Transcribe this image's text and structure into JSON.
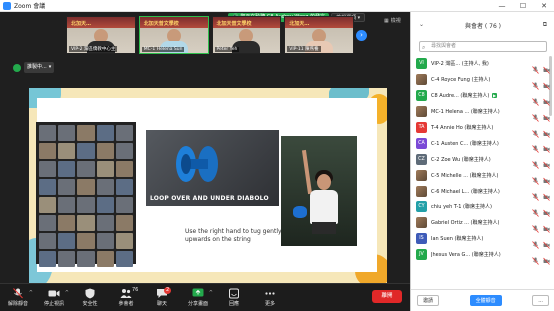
{
  "window": {
    "title": "Zoom 會議",
    "controls": [
      "—",
      "☐",
      "✕"
    ]
  },
  "meeting": {
    "banner_speaker": "您正在聆聽 C8 Audrey Wong 的發言",
    "view_options": "檢視選項 ▾",
    "view_label": "檢視",
    "host_label": "誰製中...",
    "video_strip": [
      {
        "name": "VIP-2 灣區僑教中心主",
        "sign": "北加天…"
      },
      {
        "name": "MC-1 Helena Sun",
        "sign": "北加天普文學校"
      },
      {
        "name": "Peter Yeh",
        "sign": "北加天普文學校"
      },
      {
        "name": "VIP-11 陳燕養",
        "sign": "北加天…"
      }
    ],
    "slide": {
      "caption": "LOOP OVER AND UNDER DIABOLO",
      "text": "Use the right hand to tug gently upwards on the string"
    }
  },
  "toolbar": {
    "buttons": [
      {
        "label": "解除靜音",
        "icon": "mic-muted-icon"
      },
      {
        "label": "停止視訊",
        "icon": "video-icon"
      },
      {
        "label": "安全性",
        "icon": "shield-icon"
      },
      {
        "label": "參會者",
        "icon": "participants-icon",
        "count": "76"
      },
      {
        "label": "聊天",
        "icon": "chat-icon",
        "badge": "2"
      },
      {
        "label": "分享畫面",
        "icon": "share-screen-icon"
      },
      {
        "label": "回應",
        "icon": "reaction-icon"
      },
      {
        "label": "更多",
        "icon": "more-icon"
      }
    ],
    "end_label": "離開"
  },
  "panel": {
    "title": "與會者 ( 76 )",
    "search_placeholder": "尋找與會者",
    "participants": [
      {
        "initials": "VI",
        "color": "#23a94c",
        "name": "VIP-2 灣區... (主持人, 我)"
      },
      {
        "initials": "",
        "color": "photo",
        "name": "C-4 Royce Fung (主持人)"
      },
      {
        "initials": "C8",
        "color": "#23a94c",
        "name": "C8 Audre... (聯席主持人)",
        "video": true
      },
      {
        "initials": "",
        "color": "photo",
        "name": "MC-1 Helena ... (聯席主持人)"
      },
      {
        "initials": "TA",
        "color": "#e53935",
        "name": "T-4 Annie Ho (聯席主持人)"
      },
      {
        "initials": "CA",
        "color": "#7b4ad6",
        "name": "C-1 Austen C... (聯席主持人)"
      },
      {
        "initials": "CZ",
        "color": "#5e6b78",
        "name": "C-2 Zoe Wu (聯席主持人)"
      },
      {
        "initials": "",
        "color": "photo",
        "name": "C-5 Michelle ... (聯席主持人)"
      },
      {
        "initials": "",
        "color": "photo",
        "name": "C-6 Michael L... (聯席主持人)"
      },
      {
        "initials": "CY",
        "color": "#23a0a8",
        "name": "chiu yeh T-1 (聯席主持人)"
      },
      {
        "initials": "",
        "color": "photo",
        "name": "Gabriel Ortiz ... (聯席主持人)"
      },
      {
        "initials": "IS",
        "color": "#3e5bb8",
        "name": "Ian Suen (聯席主持人)"
      },
      {
        "initials": "JV",
        "color": "#23a94c",
        "name": "Jhesus Vera G... (聯席主持人)"
      }
    ],
    "invite_label": "邀請",
    "mute_all_label": "全體靜音",
    "more_label": "..."
  }
}
